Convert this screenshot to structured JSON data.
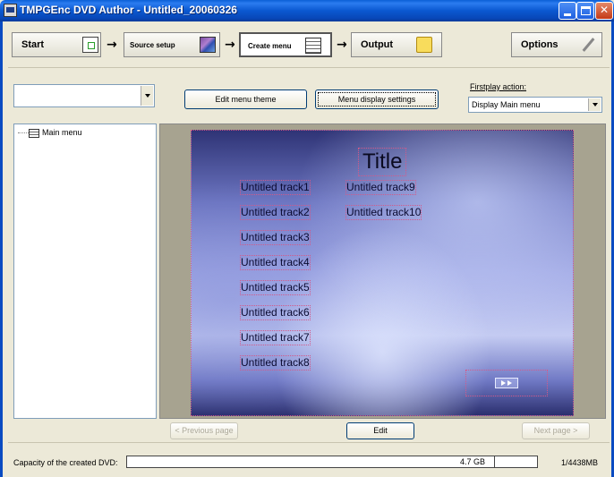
{
  "window": {
    "title": "TMPGEnc DVD Author - Untitled_20060326"
  },
  "workflow": {
    "steps": [
      {
        "label": "Start",
        "icon": "document-icon"
      },
      {
        "label": "Source setup",
        "icon": "cubes-icon"
      },
      {
        "label": "Create menu",
        "icon": "menu-icon",
        "active": true
      },
      {
        "label": "Output",
        "icon": "folder-icon"
      }
    ],
    "options_label": "Options"
  },
  "controls": {
    "theme_combo_value": "",
    "edit_menu_theme_label": "Edit menu theme",
    "menu_display_settings_label": "Menu display settings",
    "firstplay_label": "Firstplay action:",
    "firstplay_value": "Display Main menu"
  },
  "tree": {
    "items": [
      {
        "label": "Main menu"
      }
    ]
  },
  "menu_preview": {
    "title": "Title",
    "tracks": [
      "Untitled track1",
      "Untitled track2",
      "Untitled track3",
      "Untitled track4",
      "Untitled track5",
      "Untitled track6",
      "Untitled track7",
      "Untitled track8",
      "Untitled track9",
      "Untitled track10"
    ],
    "colors": {
      "highlight_outline": "#d35a8a",
      "background_dark": "#2f3476",
      "background_light": "#c4cbf2"
    }
  },
  "navigation": {
    "previous_label": "< Previous page",
    "edit_label": "Edit",
    "next_label": "Next page >"
  },
  "status": {
    "capacity_label": "Capacity of the created DVD:",
    "dvd_size": "4.7 GB",
    "used_total": "1/4438MB"
  }
}
